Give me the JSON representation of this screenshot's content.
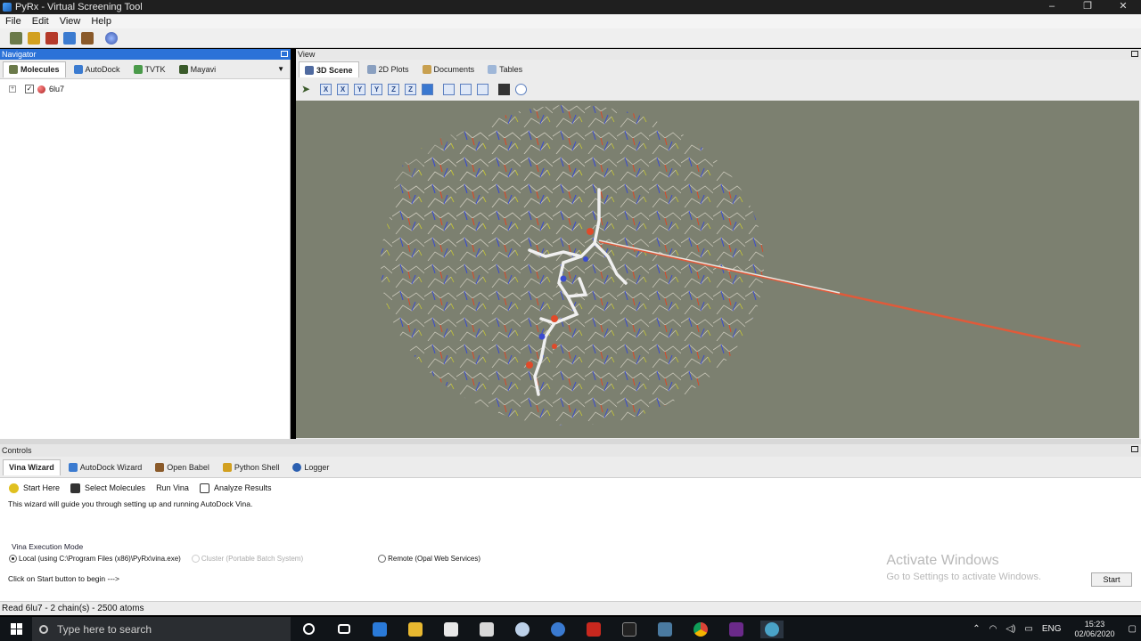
{
  "window": {
    "title": "PyRx - Virtual Screening Tool",
    "controls": [
      "–",
      "❐",
      "✕"
    ]
  },
  "menu": [
    "File",
    "Edit",
    "View",
    "Help"
  ],
  "navigator": {
    "header": "Navigator",
    "tabs": [
      "Molecules",
      "AutoDock",
      "TVTK",
      "Mayavi"
    ],
    "dropdown": "▼",
    "tree": {
      "expander": "+",
      "checked": "✓",
      "label": "6lu7"
    }
  },
  "view": {
    "header": "View",
    "tabs": [
      "3D Scene",
      "2D Plots",
      "Documents",
      "Tables"
    ],
    "tools": [
      "X",
      "X",
      "Y",
      "Y",
      "Z",
      "Z"
    ]
  },
  "controls": {
    "header": "Controls",
    "tabs": [
      "Vina Wizard",
      "AutoDock Wizard",
      "Open Babel",
      "Python Shell",
      "Logger"
    ],
    "subtabs": [
      "Start Here",
      "Select Molecules",
      "Run Vina",
      "Analyze Results"
    ],
    "wizard_text": "This wizard will guide you through setting up and running AutoDock Vina.",
    "mode_label": "Vina Execution Mode",
    "mode_local": "Local (using C:\\Program Files (x86)\\PyRx\\vina.exe)",
    "mode_cluster": "Cluster (Portable Batch System)",
    "mode_remote": "Remote (Opal Web Services)",
    "begin_text": "Click on Start button to begin --->",
    "start_button": "Start"
  },
  "watermark": {
    "title": "Activate Windows",
    "subtitle": "Go to Settings to activate Windows."
  },
  "status": "Read 6lu7 - 2 chain(s) - 2500 atoms",
  "taskbar": {
    "search_placeholder": "Type here to search",
    "lang": "ENG",
    "time": "15:23",
    "date": "02/06/2020"
  },
  "colors": {
    "scene_bg": "#7c8070",
    "navigator_header": "#2b72d8",
    "taskbar": "#101418"
  }
}
